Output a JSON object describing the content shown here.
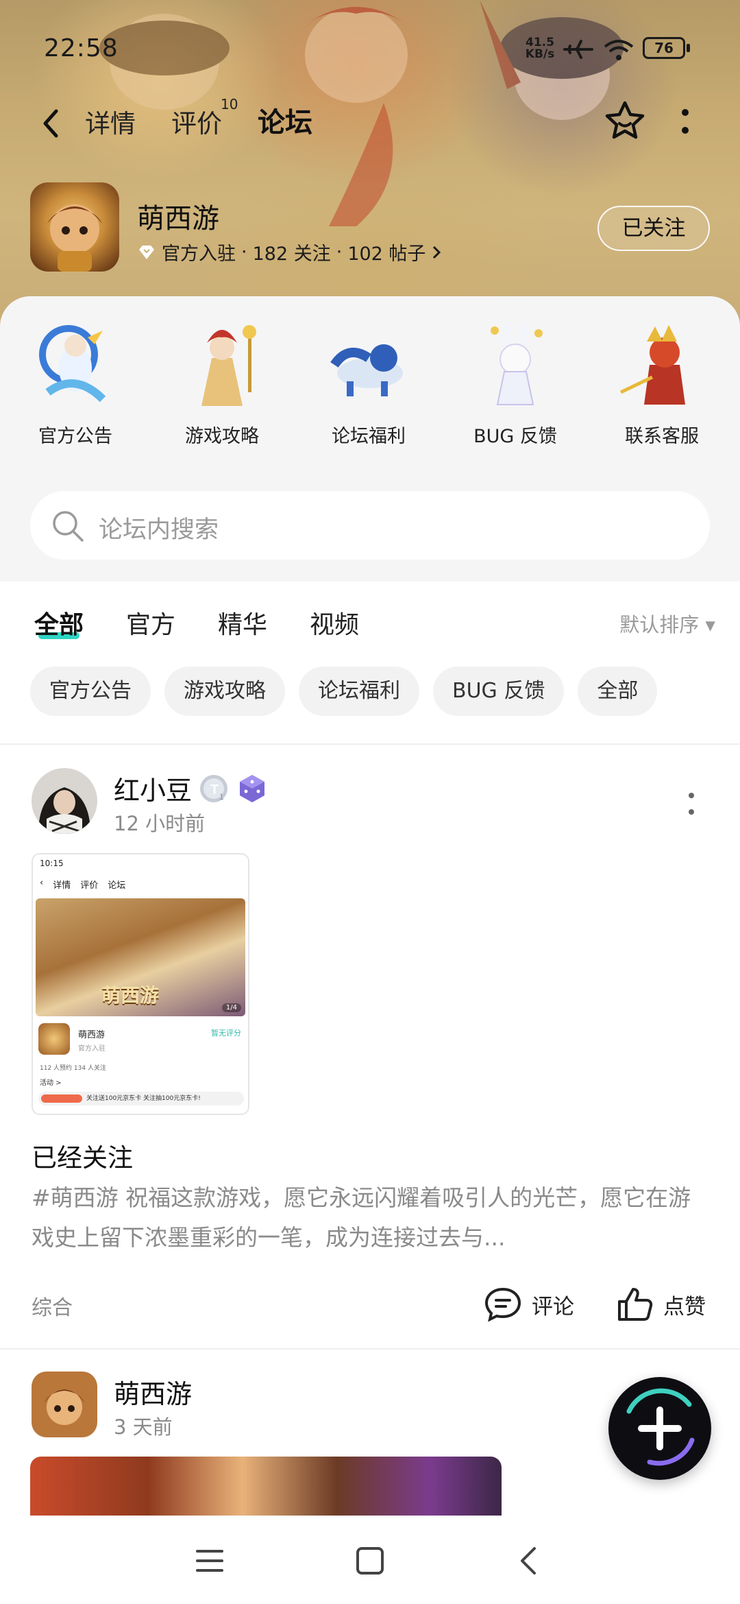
{
  "status_bar": {
    "time": "22:58",
    "net_speed_value": "41.5",
    "net_speed_unit": "KB/s",
    "battery": "76"
  },
  "nav": {
    "tabs": [
      {
        "label": "详情",
        "active": false
      },
      {
        "label": "评价",
        "active": false,
        "badge": "10"
      },
      {
        "label": "论坛",
        "active": true
      }
    ]
  },
  "game": {
    "name": "萌西游",
    "official": "官方入驻",
    "follows": "182 关注",
    "posts": "102 帖子",
    "separator": "·",
    "follow_button": "已关注"
  },
  "categories": [
    {
      "label": "官方公告",
      "icon": "blue-fox-icon"
    },
    {
      "label": "游戏攻略",
      "icon": "monk-warrior-icon"
    },
    {
      "label": "论坛福利",
      "icon": "blue-beast-icon"
    },
    {
      "label": "BUG 反馈",
      "icon": "white-rabbit-icon"
    },
    {
      "label": "联系客服",
      "icon": "red-warrior-icon"
    }
  ],
  "search": {
    "placeholder": "论坛内搜索"
  },
  "tabs": [
    {
      "label": "全部",
      "active": true
    },
    {
      "label": "官方",
      "active": false
    },
    {
      "label": "精华",
      "active": false
    },
    {
      "label": "视频",
      "active": false
    }
  ],
  "sort_label": "默认排序 ▾",
  "chips": [
    "官方公告",
    "游戏攻略",
    "论坛福利",
    "BUG 反馈",
    "全部"
  ],
  "posts": [
    {
      "author": "红小豆",
      "time": "12 小时前",
      "badge_letter": "T",
      "badge_num": "1",
      "screenshot": {
        "time": "10:15",
        "tabs": [
          "详情",
          "评价",
          "论坛"
        ],
        "game_name": "萌西游",
        "official": "官方入驻",
        "rate_link": "暂无评分",
        "stats": "112 人预约   134 人关注",
        "activity": "活动 >",
        "promo": "关注送100元京东卡 关注抽100元京东卡!",
        "logo": "萌西游",
        "page": "1/4"
      },
      "title": "已经关注",
      "body": "#萌西游 祝福这款游戏，愿它永远闪耀着吸引人的光芒，愿它在游戏史上留下浓墨重彩的一笔，成为连接过去与...",
      "tag": "综合",
      "comment_label": "评论",
      "like_label": "点赞"
    },
    {
      "author": "萌西游",
      "time": "3 天前"
    }
  ],
  "colors": {
    "accent": "#2fd4c4",
    "fab_bg": "#0e0e12"
  }
}
